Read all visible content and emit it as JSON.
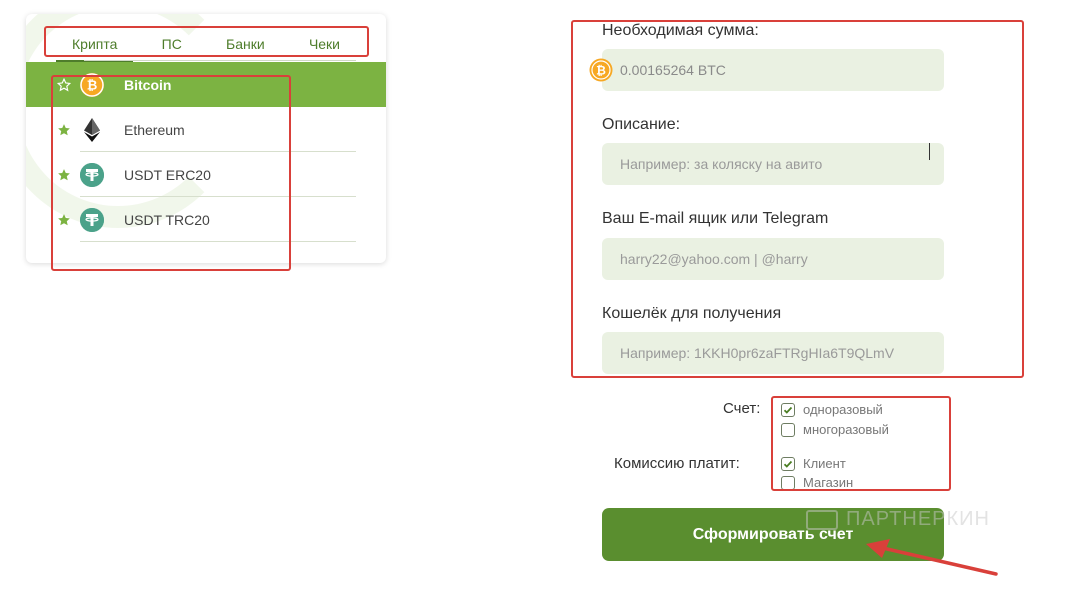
{
  "tabs": [
    {
      "label": "Крипта",
      "active": true
    },
    {
      "label": "ПС",
      "active": false
    },
    {
      "label": "Банки",
      "active": false
    },
    {
      "label": "Чеки",
      "active": false
    }
  ],
  "coins": [
    {
      "name": "Bitcoin",
      "icon": "bitcoin-icon",
      "active": true
    },
    {
      "name": "Ethereum",
      "icon": "ethereum-icon",
      "active": false
    },
    {
      "name": "USDT ERC20",
      "icon": "tether-icon",
      "active": false
    },
    {
      "name": "USDT TRC20",
      "icon": "tether-icon",
      "active": false
    }
  ],
  "form": {
    "amount_label": "Необходимая сумма:",
    "amount_value": "0.00165264 BTC",
    "description_label": "Описание:",
    "description_placeholder": "Например: за коляску на авито",
    "contact_label": "Ваш E-mail ящик или Telegram",
    "contact_placeholder": "harry22@yahoo.com | @harry",
    "wallet_label": "Кошелёк для получения",
    "wallet_placeholder": "Например: 1KKH0pr6zaFTRgHIa6T9QLmV"
  },
  "invoice": {
    "label": "Счет:",
    "options": [
      {
        "label": "одноразовый",
        "checked": true
      },
      {
        "label": "многоразовый",
        "checked": false
      }
    ]
  },
  "commission": {
    "label": "Комиссию платит:",
    "options": [
      {
        "label": "Клиент",
        "checked": true
      },
      {
        "label": "Магазин",
        "checked": false
      }
    ]
  },
  "submit_label": "Сформировать счет",
  "watermark": "ПАРТНЕРКИН",
  "colors": {
    "accent": "#7cb342",
    "button": "#5a8e2f",
    "input_bg": "#eaf1e2",
    "annotation": "#d9403a",
    "bitcoin": "#f7a823",
    "tether": "#4ba28a"
  }
}
